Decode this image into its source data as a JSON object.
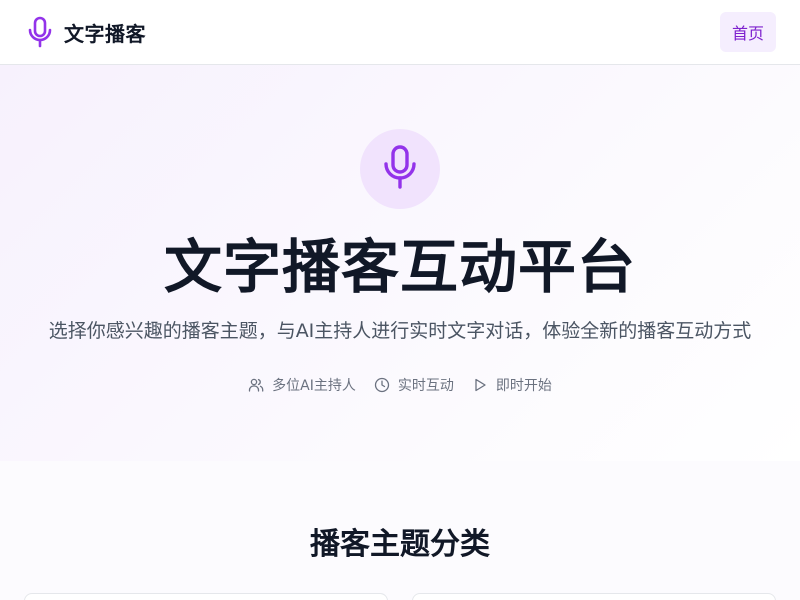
{
  "navbar": {
    "brand_name": "文字播客",
    "brand_icon": "microphone-icon",
    "home_label": "首页"
  },
  "hero": {
    "icon": "microphone-icon",
    "title": "文字播客互动平台",
    "subtitle": "选择你感兴趣的播客主题，与AI主持人进行实时文字对话，体验全新的播客互动方式",
    "features": [
      {
        "icon": "users-icon",
        "label": "多位AI主持人"
      },
      {
        "icon": "clock-icon",
        "label": "实时互动"
      },
      {
        "icon": "play-icon",
        "label": "即时开始"
      }
    ]
  },
  "categories": {
    "title": "播客主题分类"
  },
  "colors": {
    "accent": "#9333ea",
    "accent_light": "#f1e3fd",
    "text_primary": "#111827",
    "text_secondary": "#4b5563",
    "text_muted": "#6b7280"
  }
}
